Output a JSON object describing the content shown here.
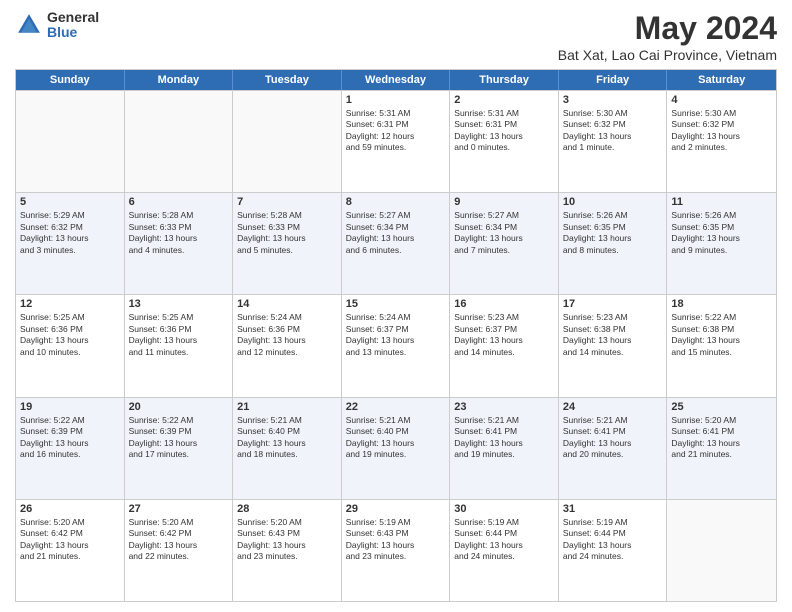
{
  "logo": {
    "general": "General",
    "blue": "Blue"
  },
  "title": "May 2024",
  "subtitle": "Bat Xat, Lao Cai Province, Vietnam",
  "weekdays": [
    "Sunday",
    "Monday",
    "Tuesday",
    "Wednesday",
    "Thursday",
    "Friday",
    "Saturday"
  ],
  "weeks": [
    [
      {
        "day": "",
        "info": "",
        "empty": true
      },
      {
        "day": "",
        "info": "",
        "empty": true
      },
      {
        "day": "",
        "info": "",
        "empty": true
      },
      {
        "day": "1",
        "info": "Sunrise: 5:31 AM\nSunset: 6:31 PM\nDaylight: 12 hours\nand 59 minutes.",
        "empty": false
      },
      {
        "day": "2",
        "info": "Sunrise: 5:31 AM\nSunset: 6:31 PM\nDaylight: 13 hours\nand 0 minutes.",
        "empty": false
      },
      {
        "day": "3",
        "info": "Sunrise: 5:30 AM\nSunset: 6:32 PM\nDaylight: 13 hours\nand 1 minute.",
        "empty": false
      },
      {
        "day": "4",
        "info": "Sunrise: 5:30 AM\nSunset: 6:32 PM\nDaylight: 13 hours\nand 2 minutes.",
        "empty": false
      }
    ],
    [
      {
        "day": "5",
        "info": "Sunrise: 5:29 AM\nSunset: 6:32 PM\nDaylight: 13 hours\nand 3 minutes.",
        "empty": false
      },
      {
        "day": "6",
        "info": "Sunrise: 5:28 AM\nSunset: 6:33 PM\nDaylight: 13 hours\nand 4 minutes.",
        "empty": false
      },
      {
        "day": "7",
        "info": "Sunrise: 5:28 AM\nSunset: 6:33 PM\nDaylight: 13 hours\nand 5 minutes.",
        "empty": false
      },
      {
        "day": "8",
        "info": "Sunrise: 5:27 AM\nSunset: 6:34 PM\nDaylight: 13 hours\nand 6 minutes.",
        "empty": false
      },
      {
        "day": "9",
        "info": "Sunrise: 5:27 AM\nSunset: 6:34 PM\nDaylight: 13 hours\nand 7 minutes.",
        "empty": false
      },
      {
        "day": "10",
        "info": "Sunrise: 5:26 AM\nSunset: 6:35 PM\nDaylight: 13 hours\nand 8 minutes.",
        "empty": false
      },
      {
        "day": "11",
        "info": "Sunrise: 5:26 AM\nSunset: 6:35 PM\nDaylight: 13 hours\nand 9 minutes.",
        "empty": false
      }
    ],
    [
      {
        "day": "12",
        "info": "Sunrise: 5:25 AM\nSunset: 6:36 PM\nDaylight: 13 hours\nand 10 minutes.",
        "empty": false
      },
      {
        "day": "13",
        "info": "Sunrise: 5:25 AM\nSunset: 6:36 PM\nDaylight: 13 hours\nand 11 minutes.",
        "empty": false
      },
      {
        "day": "14",
        "info": "Sunrise: 5:24 AM\nSunset: 6:36 PM\nDaylight: 13 hours\nand 12 minutes.",
        "empty": false
      },
      {
        "day": "15",
        "info": "Sunrise: 5:24 AM\nSunset: 6:37 PM\nDaylight: 13 hours\nand 13 minutes.",
        "empty": false
      },
      {
        "day": "16",
        "info": "Sunrise: 5:23 AM\nSunset: 6:37 PM\nDaylight: 13 hours\nand 14 minutes.",
        "empty": false
      },
      {
        "day": "17",
        "info": "Sunrise: 5:23 AM\nSunset: 6:38 PM\nDaylight: 13 hours\nand 14 minutes.",
        "empty": false
      },
      {
        "day": "18",
        "info": "Sunrise: 5:22 AM\nSunset: 6:38 PM\nDaylight: 13 hours\nand 15 minutes.",
        "empty": false
      }
    ],
    [
      {
        "day": "19",
        "info": "Sunrise: 5:22 AM\nSunset: 6:39 PM\nDaylight: 13 hours\nand 16 minutes.",
        "empty": false
      },
      {
        "day": "20",
        "info": "Sunrise: 5:22 AM\nSunset: 6:39 PM\nDaylight: 13 hours\nand 17 minutes.",
        "empty": false
      },
      {
        "day": "21",
        "info": "Sunrise: 5:21 AM\nSunset: 6:40 PM\nDaylight: 13 hours\nand 18 minutes.",
        "empty": false
      },
      {
        "day": "22",
        "info": "Sunrise: 5:21 AM\nSunset: 6:40 PM\nDaylight: 13 hours\nand 19 minutes.",
        "empty": false
      },
      {
        "day": "23",
        "info": "Sunrise: 5:21 AM\nSunset: 6:41 PM\nDaylight: 13 hours\nand 19 minutes.",
        "empty": false
      },
      {
        "day": "24",
        "info": "Sunrise: 5:21 AM\nSunset: 6:41 PM\nDaylight: 13 hours\nand 20 minutes.",
        "empty": false
      },
      {
        "day": "25",
        "info": "Sunrise: 5:20 AM\nSunset: 6:41 PM\nDaylight: 13 hours\nand 21 minutes.",
        "empty": false
      }
    ],
    [
      {
        "day": "26",
        "info": "Sunrise: 5:20 AM\nSunset: 6:42 PM\nDaylight: 13 hours\nand 21 minutes.",
        "empty": false
      },
      {
        "day": "27",
        "info": "Sunrise: 5:20 AM\nSunset: 6:42 PM\nDaylight: 13 hours\nand 22 minutes.",
        "empty": false
      },
      {
        "day": "28",
        "info": "Sunrise: 5:20 AM\nSunset: 6:43 PM\nDaylight: 13 hours\nand 23 minutes.",
        "empty": false
      },
      {
        "day": "29",
        "info": "Sunrise: 5:19 AM\nSunset: 6:43 PM\nDaylight: 13 hours\nand 23 minutes.",
        "empty": false
      },
      {
        "day": "30",
        "info": "Sunrise: 5:19 AM\nSunset: 6:44 PM\nDaylight: 13 hours\nand 24 minutes.",
        "empty": false
      },
      {
        "day": "31",
        "info": "Sunrise: 5:19 AM\nSunset: 6:44 PM\nDaylight: 13 hours\nand 24 minutes.",
        "empty": false
      },
      {
        "day": "",
        "info": "",
        "empty": true
      }
    ]
  ]
}
